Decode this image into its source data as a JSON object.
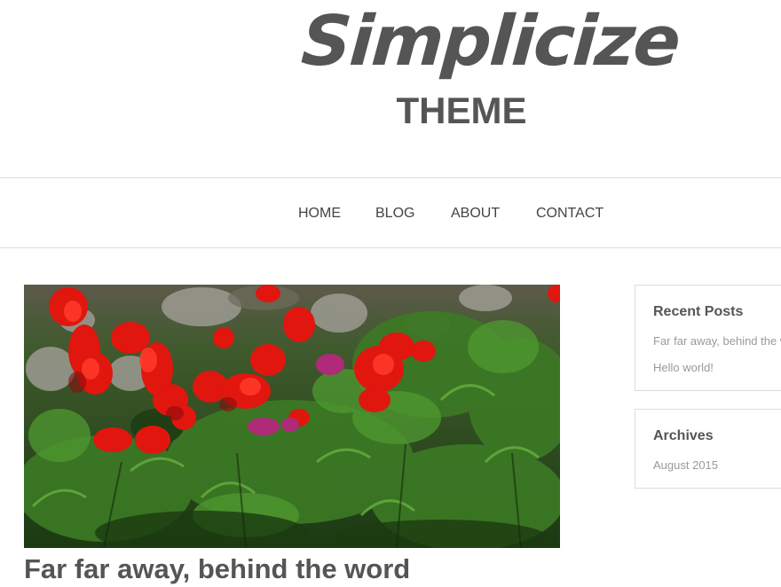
{
  "header": {
    "logo_script": "Simplicize",
    "logo_sub": "THEME"
  },
  "nav": {
    "items": [
      {
        "label": "HOME"
      },
      {
        "label": "BLOG"
      },
      {
        "label": "ABOUT"
      },
      {
        "label": "CONTACT"
      }
    ]
  },
  "post": {
    "image_icon": "flower-garden-photo",
    "title": "Far far away, behind the word"
  },
  "sidebar": {
    "recent_posts": {
      "title": "Recent Posts",
      "items": [
        {
          "label": "Far far away, behind the word"
        },
        {
          "label": "Hello world!"
        }
      ]
    },
    "archives": {
      "title": "Archives",
      "items": [
        {
          "label": "August 2015"
        }
      ]
    }
  },
  "colors": {
    "text": "#555555",
    "nav_text": "#444444",
    "link_muted": "#999999",
    "border": "#dddddd",
    "foliage": "#2f5a1e",
    "flower_red": "#e0160f",
    "flower_magenta": "#b02a7a"
  }
}
